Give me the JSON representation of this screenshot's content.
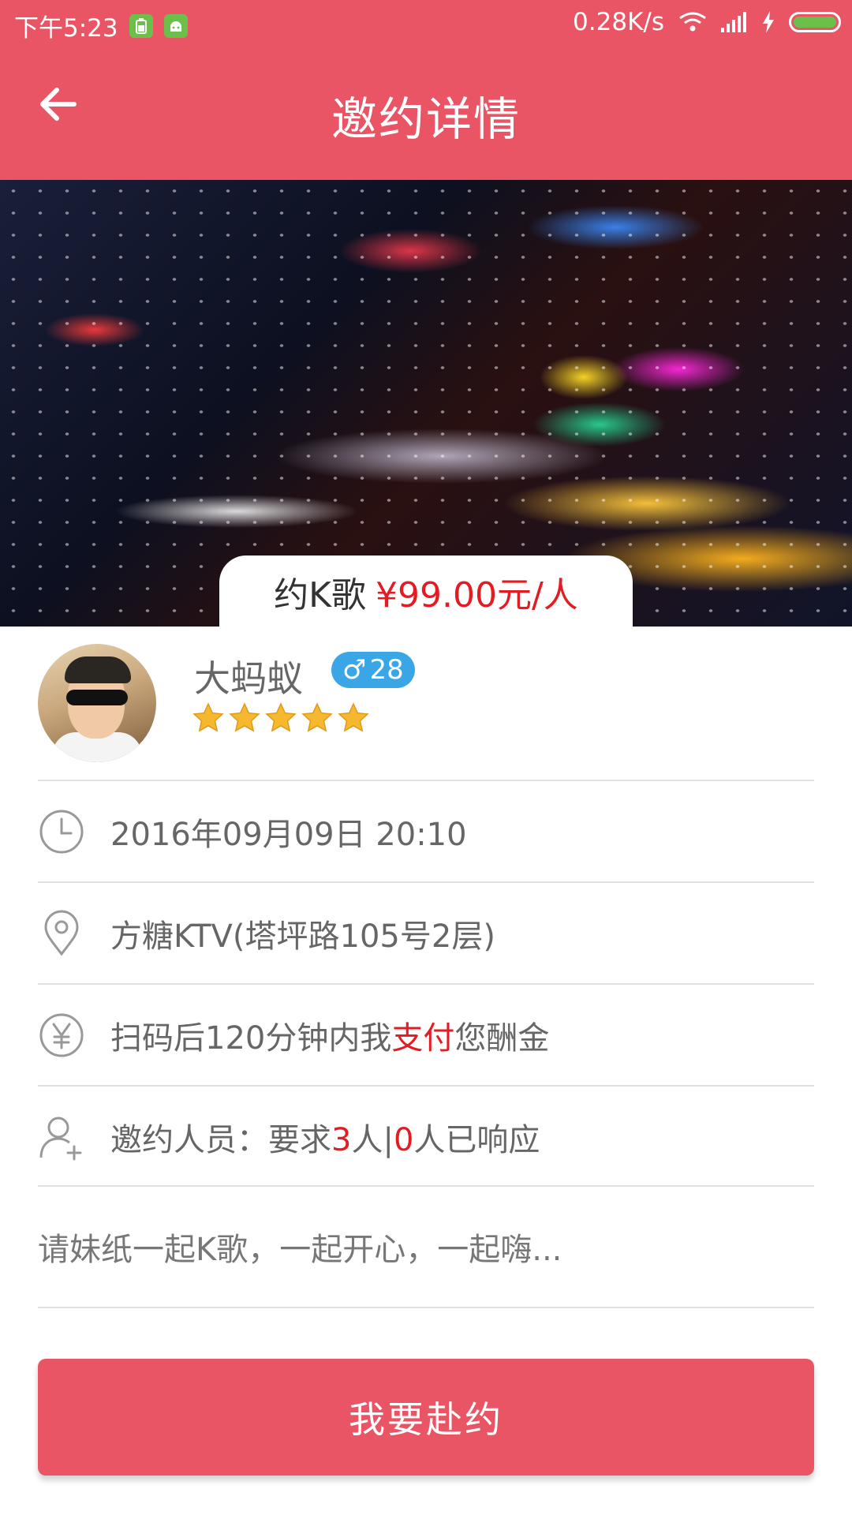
{
  "status_bar": {
    "time": "下午5:23",
    "network_speed": "0.28K/s",
    "icons": [
      "battery-saver-icon",
      "android-icon",
      "wifi-icon",
      "signal-icon",
      "charging-icon",
      "battery-icon"
    ],
    "battery_level": 1.0
  },
  "app_bar": {
    "title": "邀约详情",
    "back_icon": "arrow-left-icon"
  },
  "hero": {
    "activity": "约K歌",
    "price": "¥99.00元/人"
  },
  "host": {
    "name": "大蚂蚁",
    "gender_symbol": "♂",
    "age": "28",
    "rating_stars": 5,
    "badge_color": "#3aa6e6"
  },
  "details": {
    "datetime": "2016年09月09日 20:10",
    "location": "方糖KTV(塔坪路105号2层)",
    "payment": {
      "prefix": "扫码后120分钟内我",
      "highlight": "支付",
      "suffix": "您酬金"
    },
    "participants": {
      "label": "邀约人员：要求",
      "required": "3",
      "mid": "人|",
      "responded": "0",
      "suffix": "人已响应"
    }
  },
  "description": "请妹纸一起K歌，一起开心，一起嗨...",
  "cta_label": "我要赴约",
  "colors": {
    "primary": "#ea5565",
    "highlight": "#e31b23",
    "star": "#f5b82e",
    "divider": "#e1e1e1"
  }
}
